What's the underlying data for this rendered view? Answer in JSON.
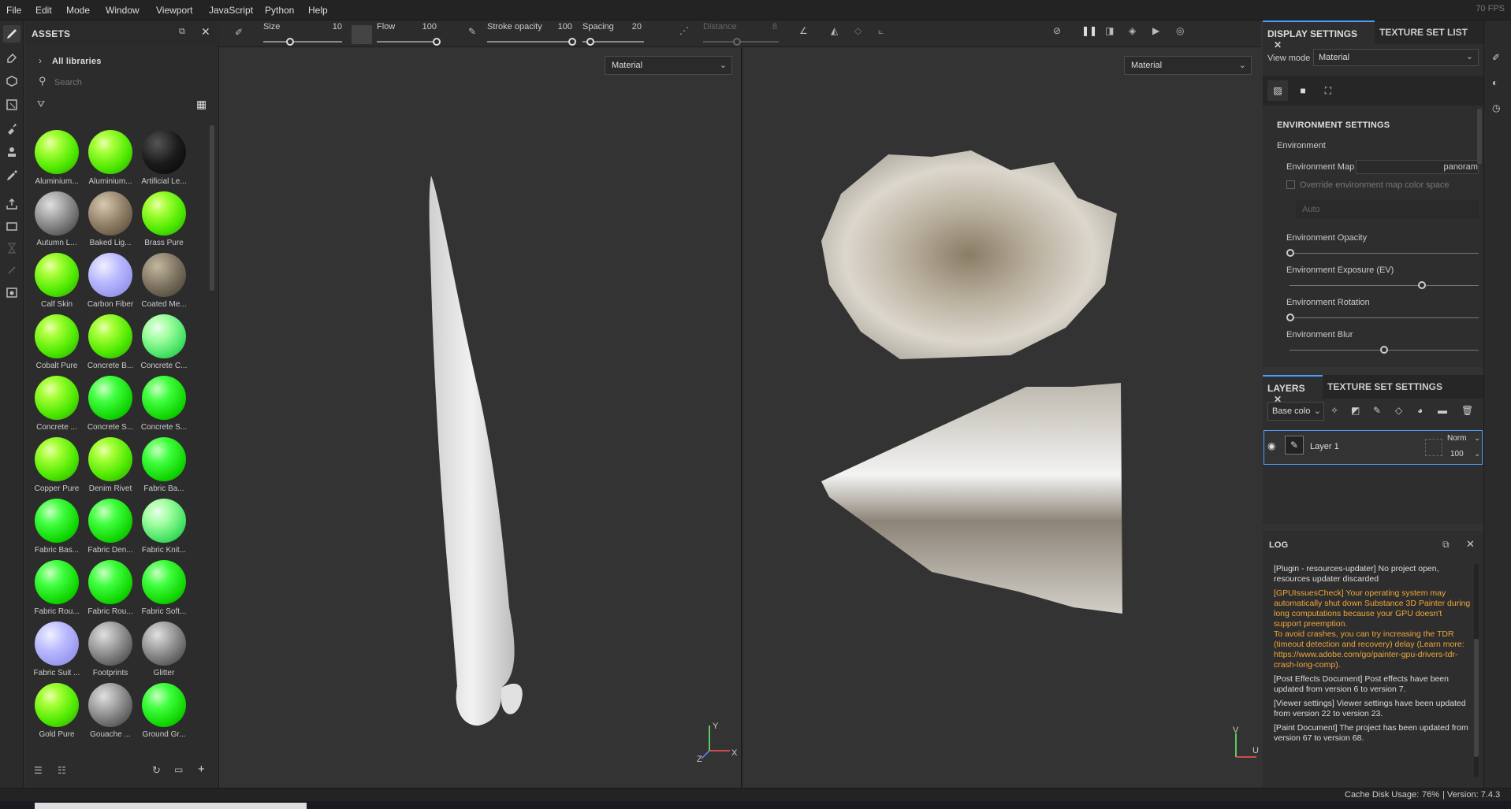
{
  "menubar": {
    "items": [
      "File",
      "Edit",
      "Mode",
      "Window",
      "Viewport",
      "JavaScript",
      "Python",
      "Help"
    ],
    "fps": "70 FPS"
  },
  "assets": {
    "title": "ASSETS",
    "library": "All libraries",
    "search_placeholder": "Search",
    "thumbnails": [
      {
        "label": "Aluminium...",
        "swatch": "green"
      },
      {
        "label": "Aluminium...",
        "swatch": "green"
      },
      {
        "label": "Artificial Le...",
        "swatch": "black"
      },
      {
        "label": "Autumn L...",
        "swatch": "grey"
      },
      {
        "label": "Baked Lig...",
        "swatch": "tan"
      },
      {
        "label": "Brass Pure",
        "swatch": "green"
      },
      {
        "label": "Calf Skin",
        "swatch": "green"
      },
      {
        "label": "Carbon Fiber",
        "swatch": "lav"
      },
      {
        "label": "Coated Me...",
        "swatch": "olive"
      },
      {
        "label": "Cobalt Pure",
        "swatch": "green"
      },
      {
        "label": "Concrete B...",
        "swatch": "green"
      },
      {
        "label": "Concrete C...",
        "swatch": "mint"
      },
      {
        "label": "Concrete ...",
        "swatch": "green"
      },
      {
        "label": "Concrete S...",
        "swatch": "green2"
      },
      {
        "label": "Concrete S...",
        "swatch": "green2"
      },
      {
        "label": "Copper Pure",
        "swatch": "green"
      },
      {
        "label": "Denim Rivet",
        "swatch": "green"
      },
      {
        "label": "Fabric Ba...",
        "swatch": "green2"
      },
      {
        "label": "Fabric Bas...",
        "swatch": "green2"
      },
      {
        "label": "Fabric Den...",
        "swatch": "green2"
      },
      {
        "label": "Fabric Knit...",
        "swatch": "mint"
      },
      {
        "label": "Fabric Rou...",
        "swatch": "green2"
      },
      {
        "label": "Fabric Rou...",
        "swatch": "green2"
      },
      {
        "label": "Fabric Soft...",
        "swatch": "green2"
      },
      {
        "label": "Fabric Suit ...",
        "swatch": "lav"
      },
      {
        "label": "Footprints",
        "swatch": "grey"
      },
      {
        "label": "Glitter",
        "swatch": "grey"
      },
      {
        "label": "Gold Pure",
        "swatch": "green"
      },
      {
        "label": "Gouache ...",
        "swatch": "grey"
      },
      {
        "label": "Ground Gr...",
        "swatch": "green2"
      }
    ]
  },
  "toolbar": {
    "size_label": "Size",
    "size_value": "10",
    "flow_label": "Flow",
    "flow_value": "100",
    "opacity_label": "Stroke opacity",
    "opacity_value": "100",
    "spacing_label": "Spacing",
    "spacing_value": "20",
    "distance_label": "Distance",
    "distance_value": "8"
  },
  "viewports": {
    "left_mode": "Material",
    "right_mode": "Material",
    "axis_x": "X",
    "axis_y": "Y",
    "axis_z": "Z",
    "uv_v": "V",
    "uv_u": "U"
  },
  "display": {
    "tab_display": "DISPLAY SETTINGS",
    "tab_texture": "TEXTURE SET LIST",
    "view_mode_label": "View mode",
    "view_mode_value": "Material",
    "section": "ENVIRONMENT SETTINGS",
    "environment": "Environment",
    "env_map_label": "Environment Map",
    "env_map_value": "panorama",
    "override_label": "Override environment map color space",
    "auto_value": "Auto",
    "opacity_label": "Environment Opacity",
    "exposure_label": "Environment Exposure (EV)",
    "rotation_label": "Environment Rotation",
    "blur_label": "Environment Blur"
  },
  "layers": {
    "tab_layers": "LAYERS",
    "tab_texture_settings": "TEXTURE SET SETTINGS",
    "channel": "Base colo",
    "layer_name": "Layer 1",
    "blend": "Norm",
    "opacity": "100"
  },
  "log": {
    "title": "LOG",
    "entries": [
      {
        "text": "[Plugin - resources-updater] No project open, resources updater discarded",
        "color": "#dddddd"
      },
      {
        "text": "[GPUIssuesCheck] Your operating system may automatically shut down Substance 3D Painter during long computations because your GPU doesn't support preemption.\nTo avoid crashes, you can try increasing the TDR (timeout detection and recovery) delay (Learn more: https://www.adobe.com/go/painter-gpu-drivers-tdr-crash-long-comp).",
        "color": "#f0a63a"
      },
      {
        "text": "[Post Effects Document] Post effects have been updated from version 6 to version 7.",
        "color": "#dddddd"
      },
      {
        "text": "[Viewer settings] Viewer settings have been updated from version 22 to version 23.",
        "color": "#dddddd"
      },
      {
        "text": "[Paint Document] The project has been updated from version 67 to version 68.",
        "color": "#dddddd"
      }
    ]
  },
  "status": {
    "cache": "Cache Disk Usage:",
    "cache_value": "76%",
    "version": "| Version: 7.4.3"
  }
}
